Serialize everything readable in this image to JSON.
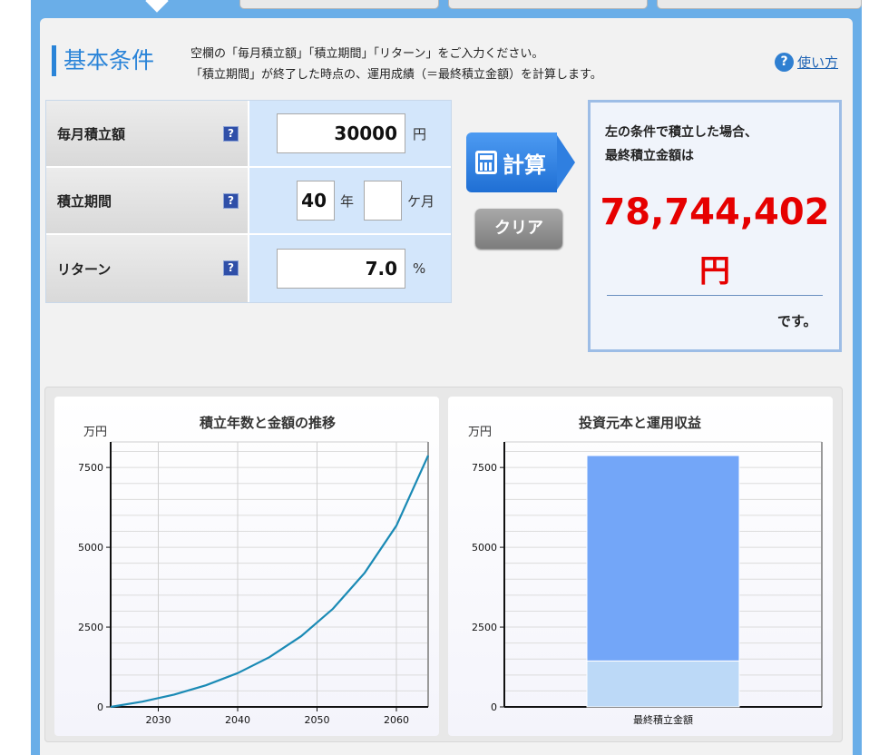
{
  "header": {
    "title": "基本条件",
    "description_line1": "空欄の「毎月積立額」「積立期間」「リターン」をご入力ください。",
    "description_line2": "「積立期間」が終了した時点の、運用成績（＝最終積立金額）を計算します。",
    "help_label": "使い方",
    "help_icon": "?"
  },
  "form": {
    "monthly": {
      "label": "毎月積立額",
      "value": "30000",
      "unit": "円"
    },
    "period": {
      "label": "積立期間",
      "years_value": "40",
      "years_unit": "年",
      "months_value": "",
      "months_unit": "ケ月"
    },
    "return": {
      "label": "リターン",
      "value": "7.0",
      "unit": "%"
    },
    "help_icon_glyph": "?"
  },
  "buttons": {
    "calc_label": "計算",
    "clear_label": "クリア"
  },
  "result": {
    "intro_line1": "左の条件で積立した場合、",
    "intro_line2": "最終積立金額は",
    "amount": "78,744,402",
    "currency": "円",
    "suffix": "です。"
  },
  "colors": {
    "accent": "#2a84d8",
    "result_red": "#e60000",
    "line": "#1a8ab5",
    "bar_gain": "#73a6f8",
    "bar_principal": "#bcd9f7"
  },
  "chart_data": [
    {
      "type": "line",
      "title": "積立年数と金額の推移",
      "ylabel": "万円",
      "xlabel": "",
      "x_ticks": [
        2030,
        2040,
        2050,
        2060
      ],
      "y_ticks": [
        0,
        2500,
        5000,
        7500
      ],
      "xlim": [
        2024,
        2064
      ],
      "ylim": [
        0,
        8300
      ],
      "grid": true,
      "series": [
        {
          "x": [
            2024,
            2028,
            2032,
            2036,
            2040,
            2044,
            2048,
            2052,
            2056,
            2060,
            2064
          ],
          "values": [
            0,
            166,
            387,
            677,
            1058,
            1558,
            2213,
            3072,
            4198,
            5675,
            7874
          ]
        }
      ]
    },
    {
      "type": "bar",
      "title": "投資元本と運用収益",
      "ylabel": "万円",
      "xlabel": "",
      "categories": [
        "最終積立金額"
      ],
      "y_ticks": [
        0,
        2500,
        5000,
        7500
      ],
      "ylim": [
        0,
        8300
      ],
      "grid": true,
      "stacked": true,
      "series": [
        {
          "values": [
            1440
          ]
        },
        {
          "values": [
            6434
          ]
        }
      ]
    }
  ]
}
